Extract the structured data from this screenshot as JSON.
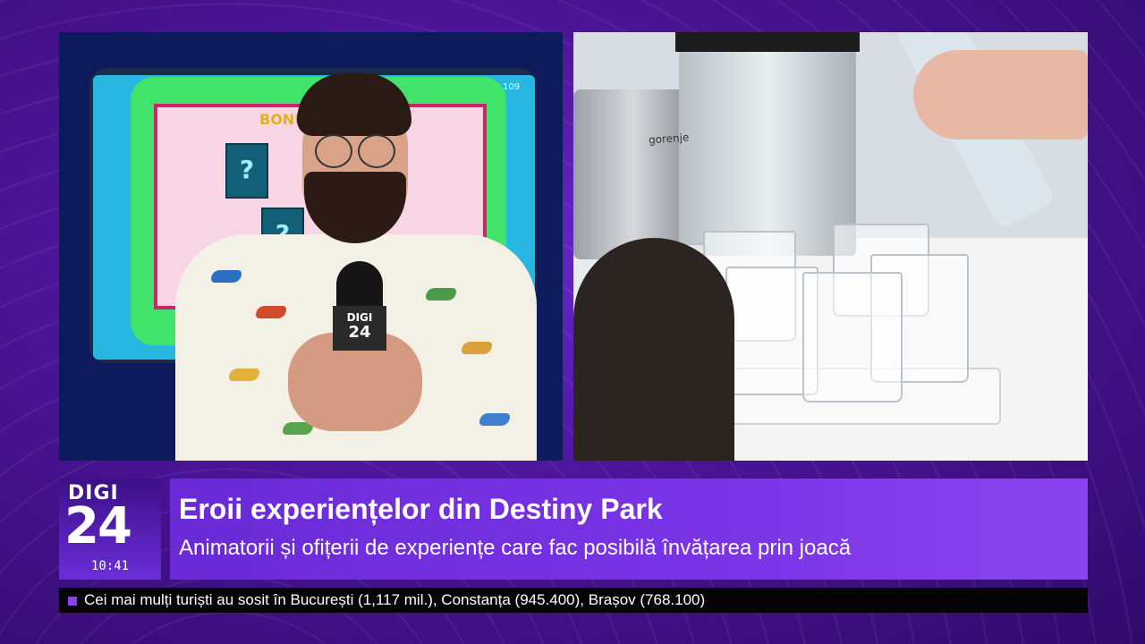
{
  "channel": {
    "logo_top": "DIGI",
    "logo_bottom": "24",
    "time": "10:41",
    "accent_color": "#7a34e6"
  },
  "left_video": {
    "screen_title": "BONU",
    "screen_number": "109",
    "tile_mark": "?",
    "mic_flag_top": "DIGI",
    "mic_flag_bottom": "24"
  },
  "right_video": {
    "blender_brand": "gorenje"
  },
  "lower_third": {
    "title": "Eroii experiențelor din Destiny Park",
    "subtitle": "Animatorii și ofițerii de experiențe care fac posibilă învățarea prin joacă"
  },
  "ticker": {
    "text": "Cei mai mulți turiști au sosit în București (1,117 mil.), Constanța (945.400), Brașov (768.100)"
  }
}
